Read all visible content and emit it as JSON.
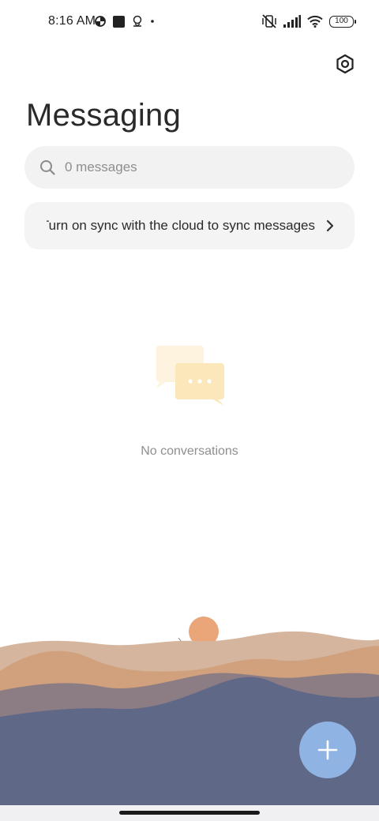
{
  "status_bar": {
    "time": "8:16 AM",
    "left_icons": [
      "data-saver-icon",
      "square-notification-icon",
      "location-pin-icon",
      "dot-icon"
    ],
    "right_icons": [
      "vibrate-mute-icon",
      "signal-icon",
      "wifi-icon"
    ],
    "battery": "100"
  },
  "header": {
    "title": "Messaging",
    "settings_icon": "settings-hexagon-icon"
  },
  "search": {
    "placeholder": "0 messages",
    "icon": "search-icon"
  },
  "sync_banner": {
    "text": "Turn on sync with the cloud to sync messages",
    "chevron_icon": "chevron-right-icon"
  },
  "empty_state": {
    "icon": "chat-bubbles-icon",
    "text": "No conversations"
  },
  "fab": {
    "icon": "plus-icon",
    "color": "#8fb3e3"
  },
  "colors": {
    "background": "#ffffff",
    "search_bg": "#f2f2f2",
    "sun": "#eaa679",
    "mountain_dark": "#5f6886",
    "fab": "#8fb3e3"
  }
}
